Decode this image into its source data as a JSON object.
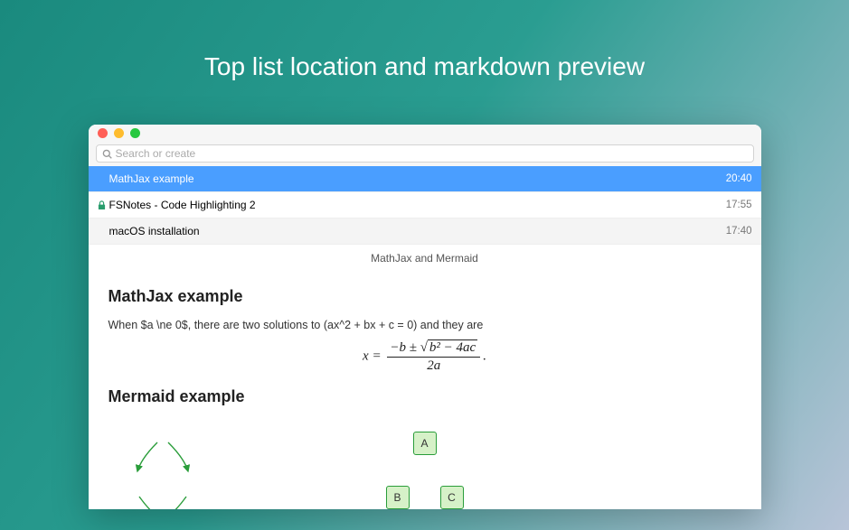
{
  "page_heading": "Top list location and markdown preview",
  "search": {
    "placeholder": "Search or create"
  },
  "notes": [
    {
      "title": "MathJax example",
      "time": "20:40",
      "selected": true,
      "locked": false
    },
    {
      "title": "FSNotes - Code Highlighting 2",
      "time": "17:55",
      "selected": false,
      "locked": true
    },
    {
      "title": "macOS installation",
      "time": "17:40",
      "selected": false,
      "locked": false
    }
  ],
  "preview": {
    "tab_title": "MathJax and Mermaid",
    "heading1": "MathJax example",
    "paragraph1": "When $a \\ne 0$, there are two solutions to (ax^2 + bx + c = 0) and they are",
    "equation": {
      "lhs": "x =",
      "numerator_pre": "−b ± ",
      "sqrt_arg": "b² − 4ac",
      "denominator": "2a",
      "trail": "."
    },
    "heading2": "Mermaid example",
    "mermaid": {
      "node_a": "A",
      "node_b": "B",
      "node_c": "C"
    }
  }
}
